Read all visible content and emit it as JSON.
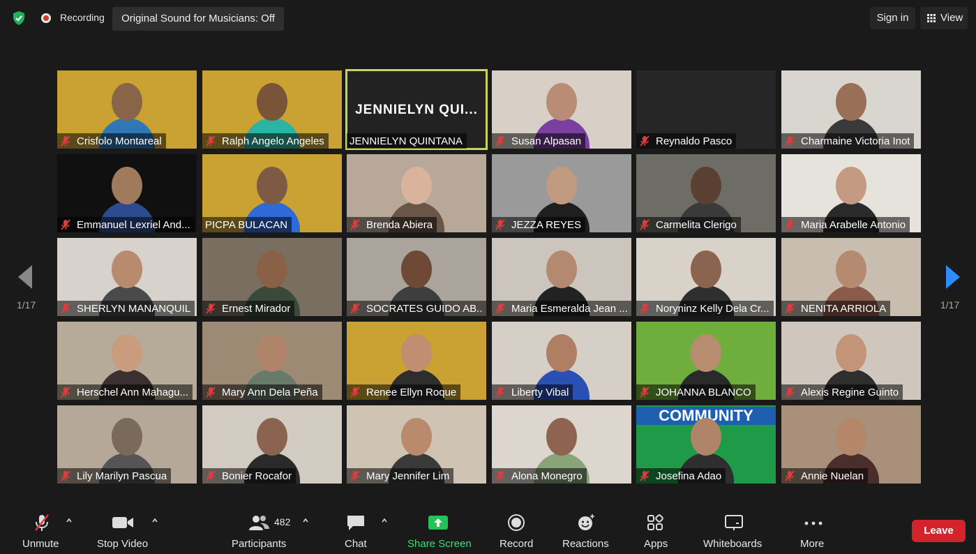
{
  "topbar": {
    "recording_label": "Recording",
    "sound_button": "Original Sound for Musicians: Off",
    "sign_in": "Sign in",
    "view": "View"
  },
  "pagination": {
    "left": "1/17",
    "right": "1/17"
  },
  "participants": [
    {
      "name": "Crisfolo Montareal",
      "muted": true,
      "bg": "#c9a233",
      "skin": "#8a6448",
      "shirt": "#2e78b8"
    },
    {
      "name": "Ralph Angelo Angeles",
      "muted": true,
      "bg": "#c9a233",
      "skin": "#7a5438",
      "shirt": "#2bb3a3"
    },
    {
      "name": "JENNIELYN QUINTANA",
      "muted": false,
      "big_label": "JENNIELYN  QUI...",
      "active": true
    },
    {
      "name": "Susan Alpasan",
      "muted": true,
      "bg": "#d8cfc6",
      "skin": "#b98d75",
      "shirt": "#7a3fa0"
    },
    {
      "name": "Reynaldo Pasco",
      "muted": true,
      "bg": "#262626",
      "no_video": true
    },
    {
      "name": "Charmaine Victoria Inot",
      "muted": true,
      "bg": "#d9d6cf",
      "skin": "#9a6f58",
      "shirt": "#3a3a3a"
    },
    {
      "name": "Emmanuel Lexriel And...",
      "muted": true,
      "bg": "#101010",
      "skin": "#a07a5c",
      "shirt": "#2d4b8f"
    },
    {
      "name": "PICPA BULACAN",
      "muted": false,
      "bg": "#c9a233",
      "skin": "#7e5a44",
      "shirt": "#2f6bd6"
    },
    {
      "name": "Brenda Abiera",
      "muted": true,
      "bg": "#b8a89a",
      "skin": "#d9b39b",
      "shirt": "#6b5548"
    },
    {
      "name": "JEZZA REYES",
      "muted": true,
      "bg": "#9a9a9a",
      "skin": "#c29a80",
      "shirt": "#1f1f1f"
    },
    {
      "name": "Carmelita Clerigo",
      "muted": true,
      "bg": "#6d6d66",
      "skin": "#5a4032",
      "shirt": "#3a3a3a"
    },
    {
      "name": "Maria Arabelle Antonio",
      "muted": true,
      "bg": "#e6e2dc",
      "skin": "#c49a82",
      "shirt": "#2a2a2a"
    },
    {
      "name": "SHERLYN MANANQUIL",
      "muted": true,
      "bg": "#d7d2cc",
      "skin": "#b88a6e",
      "shirt": "#4a4a4a"
    },
    {
      "name": "Ernest Mirador",
      "muted": true,
      "bg": "#7a6e60",
      "skin": "#8a6046",
      "shirt": "#3a4a3a"
    },
    {
      "name": "SOCRATES GUIDO AB...",
      "muted": true,
      "bg": "#aaa49c",
      "skin": "#6e4a36",
      "shirt": "#3e3e3e"
    },
    {
      "name": "Maria Esmeralda Jean ...",
      "muted": true,
      "bg": "#ccc5bd",
      "skin": "#b38a70",
      "shirt": "#222222"
    },
    {
      "name": "Noryninz Kelly Dela Cr...",
      "muted": true,
      "bg": "#d8d2c9",
      "skin": "#8a644e",
      "shirt": "#2f2f2f"
    },
    {
      "name": "NENITA ARRIOLA",
      "muted": true,
      "bg": "#c9bdb0",
      "skin": "#b48a70",
      "shirt": "#8a5a4a"
    },
    {
      "name": "Herschel Ann Mahagu...",
      "muted": true,
      "bg": "#b6aa98",
      "skin": "#c99c7e",
      "shirt": "#3a3030"
    },
    {
      "name": "Mary Ann Dela Peña",
      "muted": true,
      "bg": "#9c8a74",
      "skin": "#b08468",
      "shirt": "#6a7a6a"
    },
    {
      "name": "Renee Ellyn Roque",
      "muted": true,
      "bg": "#c9a233",
      "skin": "#c08e70",
      "shirt": "#2e2e2e"
    },
    {
      "name": "Liberty Vibal",
      "muted": true,
      "bg": "#d5cfc8",
      "skin": "#b07e62",
      "shirt": "#2a4fb5"
    },
    {
      "name": "JOHANNA BLANCO",
      "muted": true,
      "bg": "#6fae3c",
      "skin": "#b88c6e",
      "shirt": "#2a2a2a"
    },
    {
      "name": "Alexis Regine Guinto",
      "muted": true,
      "bg": "#cfc7be",
      "skin": "#c39478",
      "shirt": "#2e2e2e"
    },
    {
      "name": "Lily Marilyn Pascua",
      "muted": true,
      "bg": "#b5a898",
      "skin": "#7a6a5e",
      "shirt": "#555555"
    },
    {
      "name": "Bonier Rocafor",
      "muted": true,
      "bg": "#d2cbc2",
      "skin": "#8a6450",
      "shirt": "#2a2a2a"
    },
    {
      "name": "Mary Jennifer Lim",
      "muted": true,
      "bg": "#cfc3b4",
      "skin": "#b98a6c",
      "shirt": "#3a3a3a"
    },
    {
      "name": "Alona Monegro",
      "muted": true,
      "bg": "#dcd6cf",
      "skin": "#8e6450",
      "shirt": "#8aa47a"
    },
    {
      "name": "Josefina Adao",
      "muted": true,
      "bg": "#1f9a49",
      "skin": "#b08468",
      "shirt": "#2e2e2e",
      "banner": "COMMUNITY"
    },
    {
      "name": "Annie Nuelan",
      "muted": true,
      "bg": "#a8907a",
      "skin": "#b4866a",
      "shirt": "#4a2e2e"
    }
  ],
  "toolbar": {
    "unmute": "Unmute",
    "stop_video": "Stop Video",
    "participants": "Participants",
    "participant_count": "482",
    "chat": "Chat",
    "share_screen": "Share Screen",
    "record": "Record",
    "reactions": "Reactions",
    "apps": "Apps",
    "whiteboards": "Whiteboards",
    "more": "More",
    "leave": "Leave"
  },
  "colors": {
    "accent_green": "#28d07a",
    "leave_red": "#d3242c",
    "active_border": "#c7d65a",
    "nav_blue": "#2d8cff"
  }
}
